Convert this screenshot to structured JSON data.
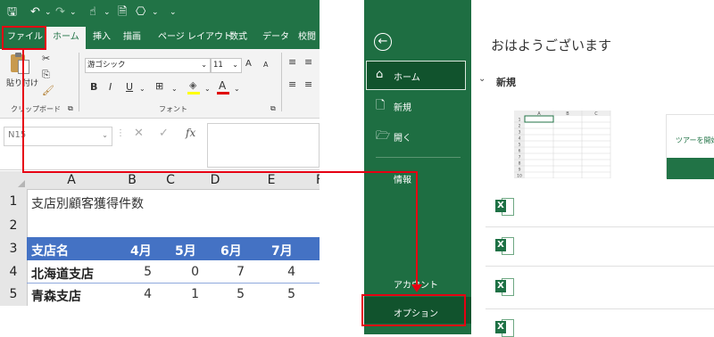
{
  "excel": {
    "tabs": [
      "ファイル",
      "ホーム",
      "挿入",
      "描画",
      "ページ レイアウト",
      "数式",
      "データ",
      "校閲"
    ],
    "ribbon": {
      "paste_label": "貼り付け",
      "font_name": "游ゴシック",
      "font_size": "11",
      "grow_font": "A",
      "shrink_font": "A",
      "bold": "B",
      "italic": "I",
      "underline": "U",
      "font_color": "A",
      "clipboard_group": "クリップボード",
      "font_group": "フォント"
    },
    "name_box": "N15",
    "fx_label": "fx",
    "columns": [
      "A",
      "B",
      "C",
      "D",
      "E",
      "F"
    ],
    "rows": [
      "1",
      "2",
      "3",
      "4",
      "5"
    ],
    "sheet": {
      "title": "支店別顧客獲得件数",
      "header": [
        "支店名",
        "4月",
        "5月",
        "6月",
        "7月"
      ],
      "data": [
        {
          "branch": "北海道支店",
          "values": [
            "5",
            "0",
            "7",
            "4"
          ]
        },
        {
          "branch": "青森支店",
          "values": [
            "4",
            "1",
            "5",
            "5"
          ]
        }
      ]
    }
  },
  "backstage": {
    "greeting": "おはようございます",
    "nav": {
      "back_icon": "back-arrow-icon",
      "home": "ホーム",
      "new": "新規",
      "open": "開く",
      "info": "情報",
      "account": "アカウント",
      "options": "オプション"
    },
    "new_section": "新規",
    "template_mini": {
      "cols": [
        "A",
        "B",
        "C"
      ],
      "rows": [
        "1",
        "2",
        "3",
        "4",
        "5",
        "6",
        "7",
        "8",
        "9",
        "10"
      ]
    },
    "tour_label": "ツアーを開始"
  },
  "colors": {
    "excel_green": "#217346",
    "backstage_green": "#1e6e42",
    "header_blue": "#4472c4",
    "annotation_red": "#e60012"
  }
}
